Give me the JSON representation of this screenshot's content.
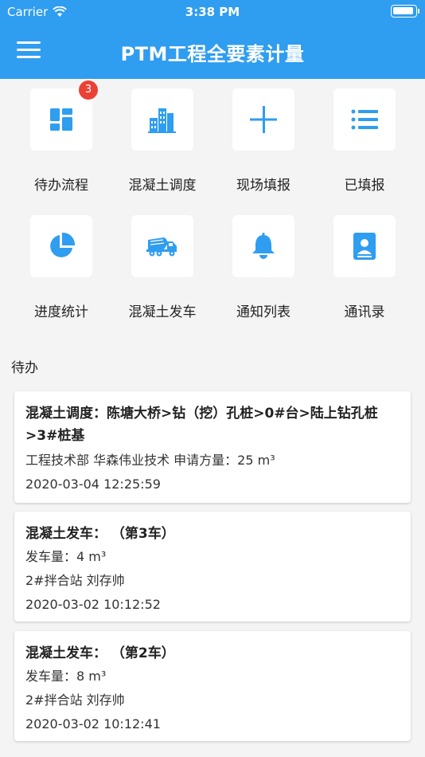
{
  "status_bar": {
    "carrier": "Carrier",
    "time": "3:38 PM"
  },
  "header": {
    "title": "PTM工程全要素计量"
  },
  "tiles": [
    {
      "label": "待办流程",
      "icon": "dashboard-icon",
      "badge": "3"
    },
    {
      "label": "混凝土调度",
      "icon": "building-icon"
    },
    {
      "label": "现场填报",
      "icon": "plus-icon"
    },
    {
      "label": "已填报",
      "icon": "list-icon"
    },
    {
      "label": "进度统计",
      "icon": "pie-chart-icon"
    },
    {
      "label": "混凝土发车",
      "icon": "mixer-truck-icon"
    },
    {
      "label": "通知列表",
      "icon": "bell-icon"
    },
    {
      "label": "通讯录",
      "icon": "contacts-icon"
    }
  ],
  "todo": {
    "section_title": "待办",
    "items": [
      {
        "title": "混凝土调度：陈塘大桥>钻（挖）孔桩>0#台>陆上钻孔桩>3#桩基",
        "line1": "工程技术部 华森伟业技术    申请方量：25 m³",
        "time": "2020-03-04 12:25:59"
      },
      {
        "title": "混凝土发车：    （第3车）",
        "line1": "发车量：4  m³",
        "line2": "2#拌合站 刘存帅",
        "time": "2020-03-02 10:12:52"
      },
      {
        "title": "混凝土发车：    （第2车）",
        "line1": "发车量：8  m³",
        "line2": "2#拌合站 刘存帅",
        "time": "2020-03-02 10:12:41"
      }
    ]
  },
  "colors": {
    "primary": "#2f9df0",
    "badge": "#ea4134",
    "background": "#f4f4f4"
  }
}
